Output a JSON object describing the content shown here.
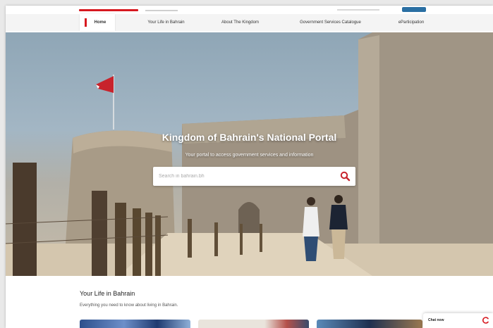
{
  "nav": {
    "items": [
      {
        "label": "Home",
        "active": true
      },
      {
        "label": "Your Life in Bahrain",
        "active": false
      },
      {
        "label": "About The Kingdom",
        "active": false
      },
      {
        "label": "Government Services Catalogue",
        "active": false
      },
      {
        "label": "eParticipation",
        "active": false
      }
    ]
  },
  "hero": {
    "title": "Kingdom of Bahrain's National Portal",
    "subtitle": "Your portal to access government services and information",
    "search_placeholder": "Search in bahrain.bh",
    "search_icon": "search-icon"
  },
  "section": {
    "title": "Your Life in Bahrain",
    "description": "Everything you need to know about living in Bahrain."
  },
  "chat": {
    "label": "Chat now",
    "icon": "chat-icon"
  },
  "colors": {
    "accent": "#d71920",
    "nav_bg": "#f4f4f4",
    "top_button": "#2a6fa3"
  }
}
